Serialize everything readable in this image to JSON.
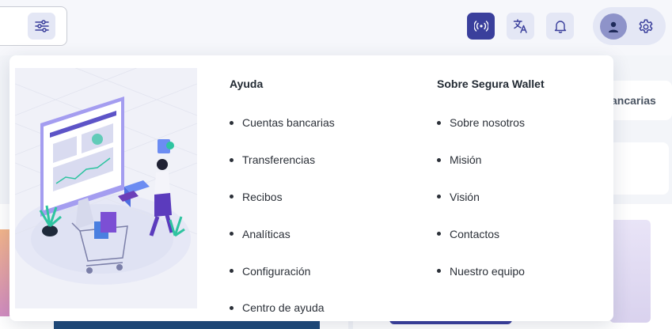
{
  "header": {
    "buttons": {
      "filter": "sliders-icon",
      "broadcast": "broadcast-icon",
      "translate": "translate-icon",
      "notifications": "bell-icon",
      "profile": "user-icon",
      "settings": "gear-icon"
    },
    "accent_color": "#3a3f9c"
  },
  "background": {
    "tab_partial_label": "ancarias"
  },
  "dropdown": {
    "help": {
      "title": "Ayuda",
      "items": [
        {
          "label": "Cuentas bancarias"
        },
        {
          "label": "Transferencias"
        },
        {
          "label": "Recibos"
        },
        {
          "label": "Analíticas"
        },
        {
          "label": "Configuración"
        },
        {
          "label": "Centro de ayuda"
        }
      ]
    },
    "about": {
      "title": "Sobre Segura Wallet",
      "items": [
        {
          "label": "Sobre nosotros"
        },
        {
          "label": "Misión"
        },
        {
          "label": "Visión"
        },
        {
          "label": "Contactos"
        },
        {
          "label": "Nuestro equipo"
        }
      ]
    },
    "illustration": "online-shopping-illustration"
  }
}
